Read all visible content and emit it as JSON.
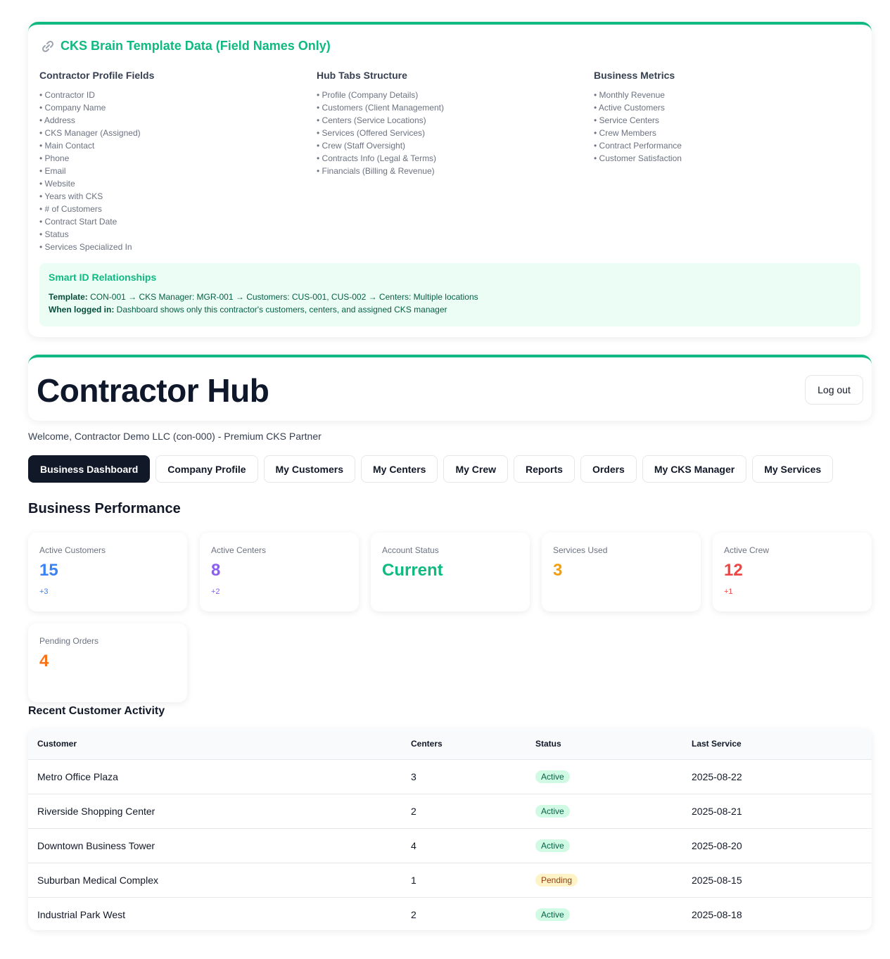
{
  "template": {
    "title": "CKS Brain Template Data (Field Names Only)",
    "columns": [
      {
        "heading": "Contractor Profile Fields",
        "items": [
          "Contractor ID",
          "Company Name",
          "Address",
          "CKS Manager (Assigned)",
          "Main Contact",
          "Phone",
          "Email",
          "Website",
          "Years with CKS",
          "# of Customers",
          "Contract Start Date",
          "Status",
          "Services Specialized In"
        ]
      },
      {
        "heading": "Hub Tabs Structure",
        "items": [
          "Profile (Company Details)",
          "Customers (Client Management)",
          "Centers (Service Locations)",
          "Services (Offered Services)",
          "Crew (Staff Oversight)",
          "Contracts Info (Legal & Terms)",
          "Financials (Billing & Revenue)"
        ]
      },
      {
        "heading": "Business Metrics",
        "items": [
          "Monthly Revenue",
          "Active Customers",
          "Service Centers",
          "Crew Members",
          "Contract Performance",
          "Customer Satisfaction"
        ]
      }
    ],
    "smart": {
      "heading": "Smart ID Relationships",
      "line1_label": "Template:",
      "line1_text": " CON-001 → CKS Manager: MGR-001 → Customers: CUS-001, CUS-002 → Centers: Multiple locations",
      "line2_label": "When logged in:",
      "line2_text": " Dashboard shows only this contractor's customers, centers, and assigned CKS manager"
    }
  },
  "hub": {
    "title": "Contractor Hub",
    "logout_label": "Log out",
    "welcome": "Welcome, Contractor Demo LLC (con-000) - Premium CKS Partner"
  },
  "tabs": [
    "Business Dashboard",
    "Company Profile",
    "My Customers",
    "My Centers",
    "My Crew",
    "Reports",
    "Orders",
    "My CKS Manager",
    "My Services"
  ],
  "active_tab": "Business Dashboard",
  "performance": {
    "title": "Business Performance",
    "stats": [
      {
        "label": "Active Customers",
        "value": "15",
        "change": "+3",
        "color": "#3b82f6"
      },
      {
        "label": "Active Centers",
        "value": "8",
        "change": "+2",
        "color": "#8b5cf6"
      },
      {
        "label": "Account Status",
        "value": "Current",
        "change": "",
        "color": "#10b981"
      },
      {
        "label": "Services Used",
        "value": "3",
        "change": "",
        "color": "#f59e0b"
      },
      {
        "label": "Active Crew",
        "value": "12",
        "change": "+1",
        "color": "#ef4444"
      },
      {
        "label": "Pending Orders",
        "value": "4",
        "change": "",
        "color": "#f97316"
      }
    ]
  },
  "activity": {
    "title": "Recent Customer Activity",
    "headers": [
      "Customer",
      "Centers",
      "Status",
      "Last Service"
    ],
    "rows": [
      {
        "customer": "Metro Office Plaza",
        "centers": "3",
        "status": "Active",
        "last_service": "2025-08-22"
      },
      {
        "customer": "Riverside Shopping Center",
        "centers": "2",
        "status": "Active",
        "last_service": "2025-08-21"
      },
      {
        "customer": "Downtown Business Tower",
        "centers": "4",
        "status": "Active",
        "last_service": "2025-08-20"
      },
      {
        "customer": "Suburban Medical Complex",
        "centers": "1",
        "status": "Pending",
        "last_service": "2025-08-15"
      },
      {
        "customer": "Industrial Park West",
        "centers": "2",
        "status": "Active",
        "last_service": "2025-08-18"
      }
    ],
    "status_colors": {
      "Active": {
        "bg": "#d1fae5",
        "fg": "#065f46"
      },
      "Pending": {
        "bg": "#fef3c7",
        "fg": "#92400e"
      }
    }
  }
}
